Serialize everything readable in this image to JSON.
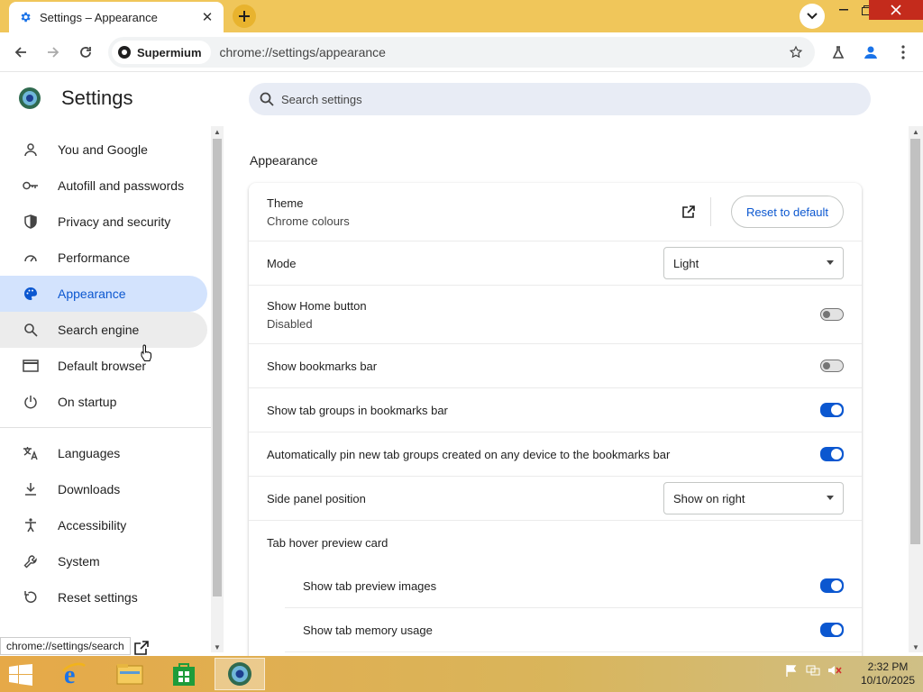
{
  "browser": {
    "tab_title": "Settings – Appearance",
    "site_chip": "Supermium",
    "url": "chrome://settings/appearance"
  },
  "settings": {
    "title": "Settings",
    "search_placeholder": "Search settings"
  },
  "sidebar": {
    "items": [
      {
        "label": "You and Google",
        "icon": "person-icon"
      },
      {
        "label": "Autofill and passwords",
        "icon": "key-icon"
      },
      {
        "label": "Privacy and security",
        "icon": "shield-icon"
      },
      {
        "label": "Performance",
        "icon": "speedometer-icon"
      },
      {
        "label": "Appearance",
        "icon": "palette-icon",
        "active": true
      },
      {
        "label": "Search engine",
        "icon": "search-icon",
        "hover": true
      },
      {
        "label": "Default browser",
        "icon": "browser-window-icon"
      },
      {
        "label": "On startup",
        "icon": "power-icon"
      }
    ],
    "items2": [
      {
        "label": "Languages",
        "icon": "translate-icon"
      },
      {
        "label": "Downloads",
        "icon": "download-icon"
      },
      {
        "label": "Accessibility",
        "icon": "accessibility-icon"
      },
      {
        "label": "System",
        "icon": "wrench-icon"
      },
      {
        "label": "Reset settings",
        "icon": "reset-icon"
      }
    ]
  },
  "appearance": {
    "section_title": "Appearance",
    "theme_label": "Theme",
    "theme_sub": "Chrome colours",
    "reset_label": "Reset to default",
    "mode_label": "Mode",
    "mode_value": "Light",
    "home_label": "Show Home button",
    "home_sub": "Disabled",
    "home_on": false,
    "bookmarks_label": "Show bookmarks bar",
    "bookmarks_on": false,
    "tabgroups_label": "Show tab groups in bookmarks bar",
    "tabgroups_on": true,
    "autopin_label": "Automatically pin new tab groups created on any device to the bookmarks bar",
    "autopin_on": true,
    "sidepanel_label": "Side panel position",
    "sidepanel_value": "Show on right",
    "hovercard_label": "Tab hover preview card",
    "preview_images_label": "Show tab preview images",
    "preview_images_on": true,
    "memory_label": "Show tab memory usage",
    "memory_on": true
  },
  "status_url": "chrome://settings/search",
  "taskbar": {
    "time": "2:32 PM",
    "date": "10/10/2025"
  },
  "colors": {
    "accent": "#0b57d0",
    "active_nav_bg": "#d3e3fd",
    "titlebar": "#f0c65a"
  }
}
